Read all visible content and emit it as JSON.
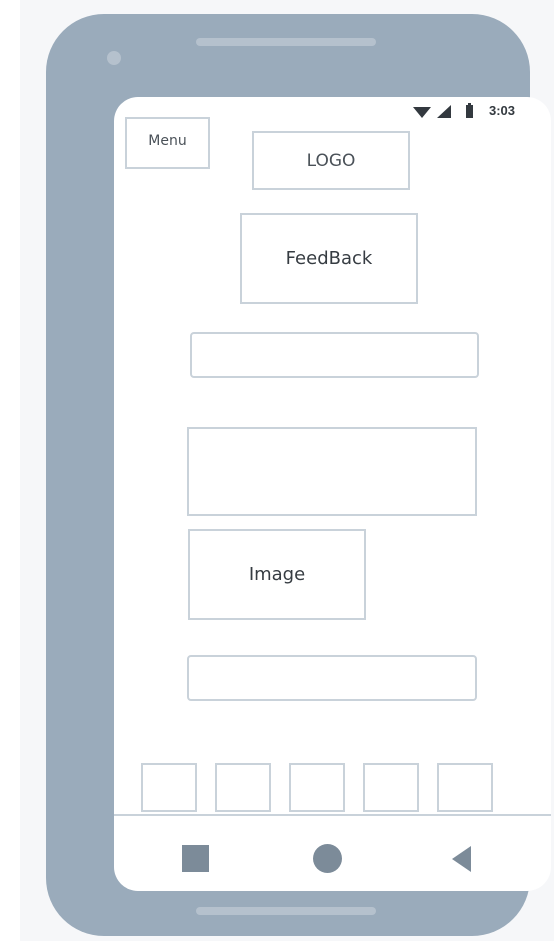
{
  "status_bar": {
    "time": "3:03",
    "icons": [
      "wifi-icon",
      "signal-icon",
      "battery-icon"
    ]
  },
  "header": {
    "menu_label": "Menu",
    "logo_label": "LOGO"
  },
  "main": {
    "feedback_label": "FeedBack",
    "input_1_value": "",
    "text_area_value": "",
    "image_label": "Image",
    "input_2_value": ""
  },
  "thumbnails": [
    "",
    "",
    "",
    "",
    ""
  ],
  "nav_bar": {
    "buttons": [
      "recent-apps-icon",
      "home-icon",
      "back-icon"
    ]
  },
  "colors": {
    "phone_frame": "#9aabbb",
    "wireframe_border": "#c9d2da",
    "nav_icons": "#7c8b99",
    "text": "#4a5158"
  }
}
